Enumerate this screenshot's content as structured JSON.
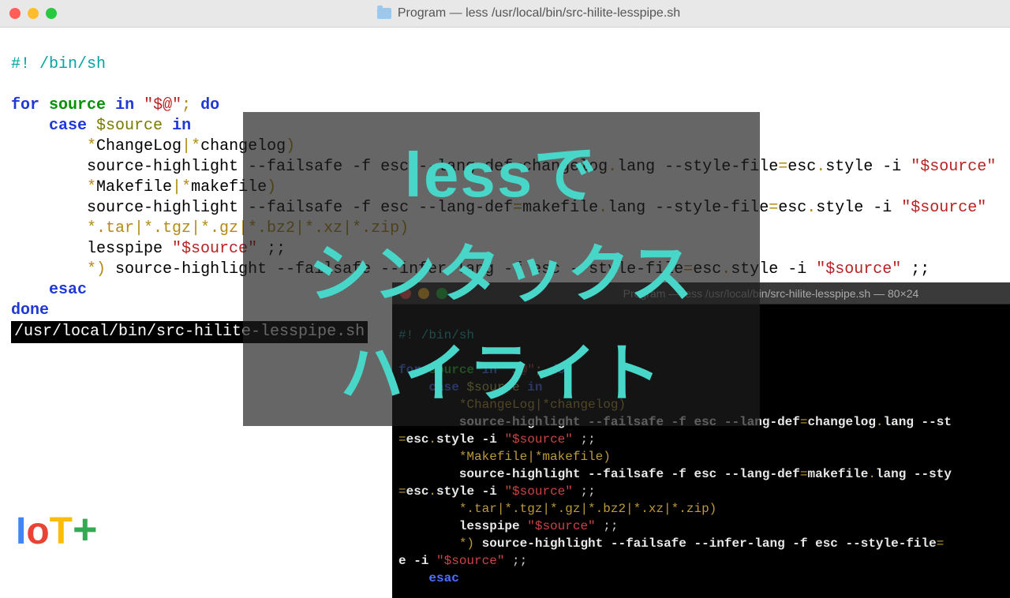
{
  "light": {
    "title": "Program — less /usr/local/bin/src-hilite-lesspipe.sh",
    "shebang": "#! /bin/sh",
    "for": "for",
    "source": "source",
    "in": "in",
    "arg": "\"$@\"",
    "semi": ";",
    "do": "do",
    "case": "case",
    "var": "$source",
    "in2": "in",
    "pat1a": "*",
    "pat1b": "ChangeLog",
    "pat1c": "|",
    "pat1d": "*",
    "pat1e": "changelog",
    "pat1f": ")",
    "sh1a": "source-highlight --failsafe -f esc --lang-def",
    "sh1b": "=",
    "sh1c": "changelog",
    "sh1d": ".",
    "sh1e": "lang --style-file",
    "sh1f": "=",
    "sh1g": "esc",
    "sh1h": ".",
    "sh1i": "style -i ",
    "sh1j": "\"$source\"",
    "pat2a": "*",
    "pat2b": "Makefile",
    "pat2c": "|",
    "pat2d": "*",
    "pat2e": "makefile",
    "pat2f": ")",
    "sh2a": "source-highlight --failsafe -f esc --lang-def",
    "sh2b": "=",
    "sh2c": "makefile",
    "sh2d": ".",
    "sh2e": "lang --style-file",
    "sh2f": "=",
    "sh2g": "esc",
    "sh2h": ".",
    "sh2i": "style -i ",
    "sh2j": "\"$source\"",
    "pat3": "*.tar|*.tgz|*.gz|*.bz2|*.xz|*.zip)",
    "lp": "lesspipe ",
    "lpvar": "\"$source\"",
    "lptail": " ;;",
    "def1": "*",
    "def2": ")",
    "sh3a": " source-highlight --failsafe --infer-lang -f esc --style-file",
    "sh3b": "=",
    "sh3c": "esc",
    "sh3d": ".",
    "sh3e": "style -i ",
    "sh3f": "\"$source\"",
    "sh3g": " ;;",
    "esac": "esac",
    "done": "done",
    "status": "/usr/local/bin/src-hilite-lesspipe.sh"
  },
  "dark": {
    "title": "Program — less /usr/local/bin/src-hilite-lesspipe.sh — 80×24",
    "shebang": "#! /bin/sh",
    "for": "for",
    "source": "source",
    "in": "in",
    "arg": "\"$@\"",
    "semi": ";",
    "do": "do",
    "case": "case",
    "var": "$source",
    "in2": "in",
    "pat1": "*ChangeLog|*changelog)",
    "sh1a": "source-highlight --failsafe -f esc --lang-def",
    "sh1b": "=",
    "sh1c": "changelog",
    "sh1d": ".",
    "sh1e": "lang --st",
    "cont1a": "=",
    "cont1b": "esc",
    "cont1c": ".",
    "cont1d": "style -i ",
    "cont1e": "\"$source\"",
    "cont1f": " ;;",
    "pat2": "*Makefile|*makefile)",
    "sh2a": "source-highlight --failsafe -f esc --lang-def",
    "sh2b": "=",
    "sh2c": "makefile",
    "sh2d": ".",
    "sh2e": "lang --sty",
    "cont2a": "=",
    "cont2b": "esc",
    "cont2c": ".",
    "cont2d": "style -i ",
    "cont2e": "\"$source\"",
    "cont2f": " ;;",
    "pat3": "*.tar|*.tgz|*.gz|*.bz2|*.xz|*.zip)",
    "lp": "lesspipe ",
    "lpvar": "\"$source\"",
    "lptail": " ;;",
    "def1": "*",
    "def2": ")",
    "sh3a": " source-highlight --failsafe --infer-lang -f esc --style-file",
    "sh3b": "=",
    "cont3a": "e -i ",
    "cont3b": "\"$source\"",
    "cont3c": " ;;",
    "esac": "esac"
  },
  "overlay": {
    "line1": "lessで",
    "line2": "シンタックス",
    "line3": "ハイライト"
  },
  "logo": {
    "a": "I",
    "b": "o",
    "c": "T",
    "d": "+"
  }
}
